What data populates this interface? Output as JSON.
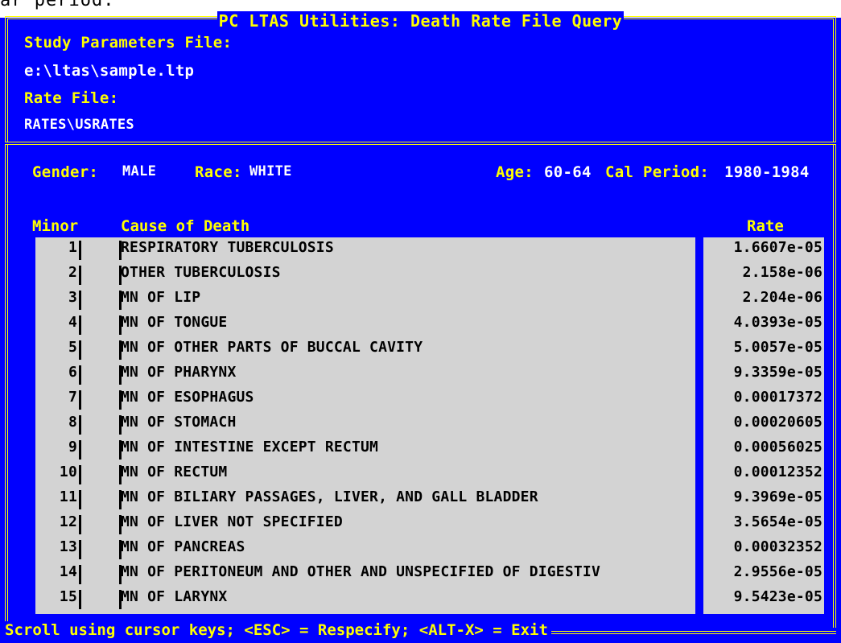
{
  "top_strip": {
    "text": "ar period."
  },
  "window": {
    "title": "PC LTAS Utilities: Death Rate File Query"
  },
  "params": {
    "study_label": "Study Parameters File:",
    "study_value": "e:\\ltas\\sample.ltp",
    "rate_label": "Rate File:",
    "rate_value": "RATES\\USRATES"
  },
  "context": {
    "gender_label": "Gender:",
    "gender_value": "MALE",
    "race_label": "Race:",
    "race_value": "WHITE",
    "age_label": "Age:",
    "age_value": "60-64",
    "period_label": "Cal Period:",
    "period_value": "1980-1984"
  },
  "columns": {
    "minor": "Minor",
    "cause": "Cause of Death",
    "rate": "Rate"
  },
  "rows": [
    {
      "minor": "1",
      "cause": "RESPIRATORY TUBERCULOSIS",
      "rate": "1.6607e-05"
    },
    {
      "minor": "2",
      "cause": "OTHER TUBERCULOSIS",
      "rate": "2.158e-06"
    },
    {
      "minor": "3",
      "cause": "MN OF LIP",
      "rate": "2.204e-06"
    },
    {
      "minor": "4",
      "cause": "MN OF TONGUE",
      "rate": "4.0393e-05"
    },
    {
      "minor": "5",
      "cause": "MN OF OTHER PARTS OF BUCCAL CAVITY",
      "rate": "5.0057e-05"
    },
    {
      "minor": "6",
      "cause": "MN OF PHARYNX",
      "rate": "9.3359e-05"
    },
    {
      "minor": "7",
      "cause": "MN OF ESOPHAGUS",
      "rate": "0.00017372"
    },
    {
      "minor": "8",
      "cause": "MN OF STOMACH",
      "rate": "0.00020605"
    },
    {
      "minor": "9",
      "cause": "MN OF INTESTINE EXCEPT RECTUM",
      "rate": "0.00056025"
    },
    {
      "minor": "10",
      "cause": "MN OF RECTUM",
      "rate": "0.00012352"
    },
    {
      "minor": "11",
      "cause": "MN OF BILIARY PASSAGES, LIVER, AND GALL BLADDER",
      "rate": "9.3969e-05"
    },
    {
      "minor": "12",
      "cause": "MN OF LIVER NOT SPECIFIED",
      "rate": "3.5654e-05"
    },
    {
      "minor": "13",
      "cause": "MN OF PANCREAS",
      "rate": "0.00032352"
    },
    {
      "minor": "14",
      "cause": "MN OF PERITONEUM AND OTHER AND UNSPECIFIED OF DIGESTIV",
      "rate": "2.9556e-05"
    },
    {
      "minor": "15",
      "cause": "MN OF LARYNX",
      "rate": "9.5423e-05"
    }
  ],
  "status_bar": {
    "text": "Scroll using cursor keys; <ESC> = Respecify; <ALT-X> = Exit"
  },
  "colors": {
    "background": "#0000ff",
    "label": "#ffff00",
    "value": "#ffffff",
    "table_bg": "#d3d3d3",
    "table_text": "#000000"
  }
}
